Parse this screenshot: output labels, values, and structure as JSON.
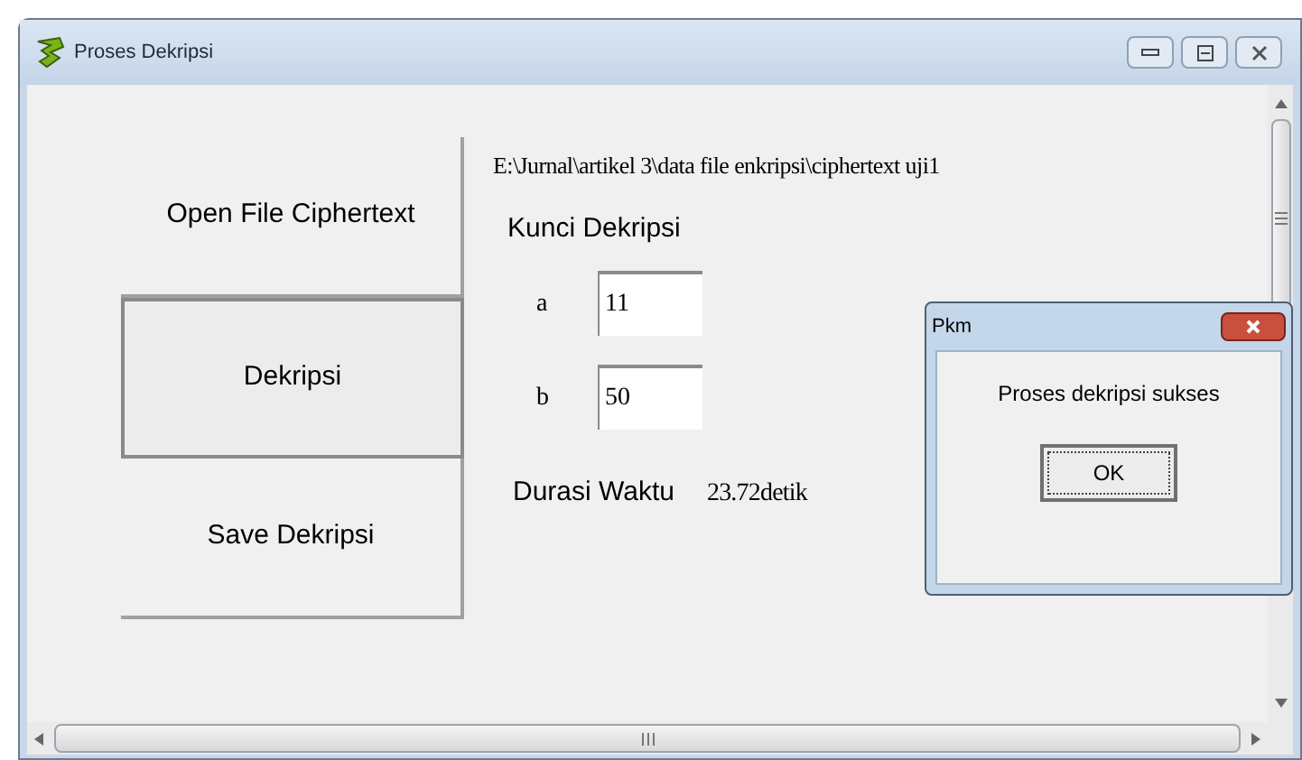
{
  "window": {
    "title": "Proses Dekripsi"
  },
  "buttons": [
    {
      "label": "Open File Ciphertext",
      "focused": false
    },
    {
      "label": "Dekripsi",
      "focused": true
    },
    {
      "label": "Save Dekripsi",
      "focused": false
    }
  ],
  "file_path": "E:\\Jurnal\\artikel 3\\data file enkripsi\\ciphertext uji1",
  "key_section": {
    "label": "Kunci Dekripsi",
    "fields": [
      {
        "label": "a",
        "value": "11"
      },
      {
        "label": "b",
        "value": "50"
      }
    ]
  },
  "duration": {
    "label": "Durasi Waktu",
    "value": "23.72detik"
  },
  "dialog": {
    "title": "Pkm",
    "message": "Proses dekripsi sukses",
    "button": "OK"
  }
}
